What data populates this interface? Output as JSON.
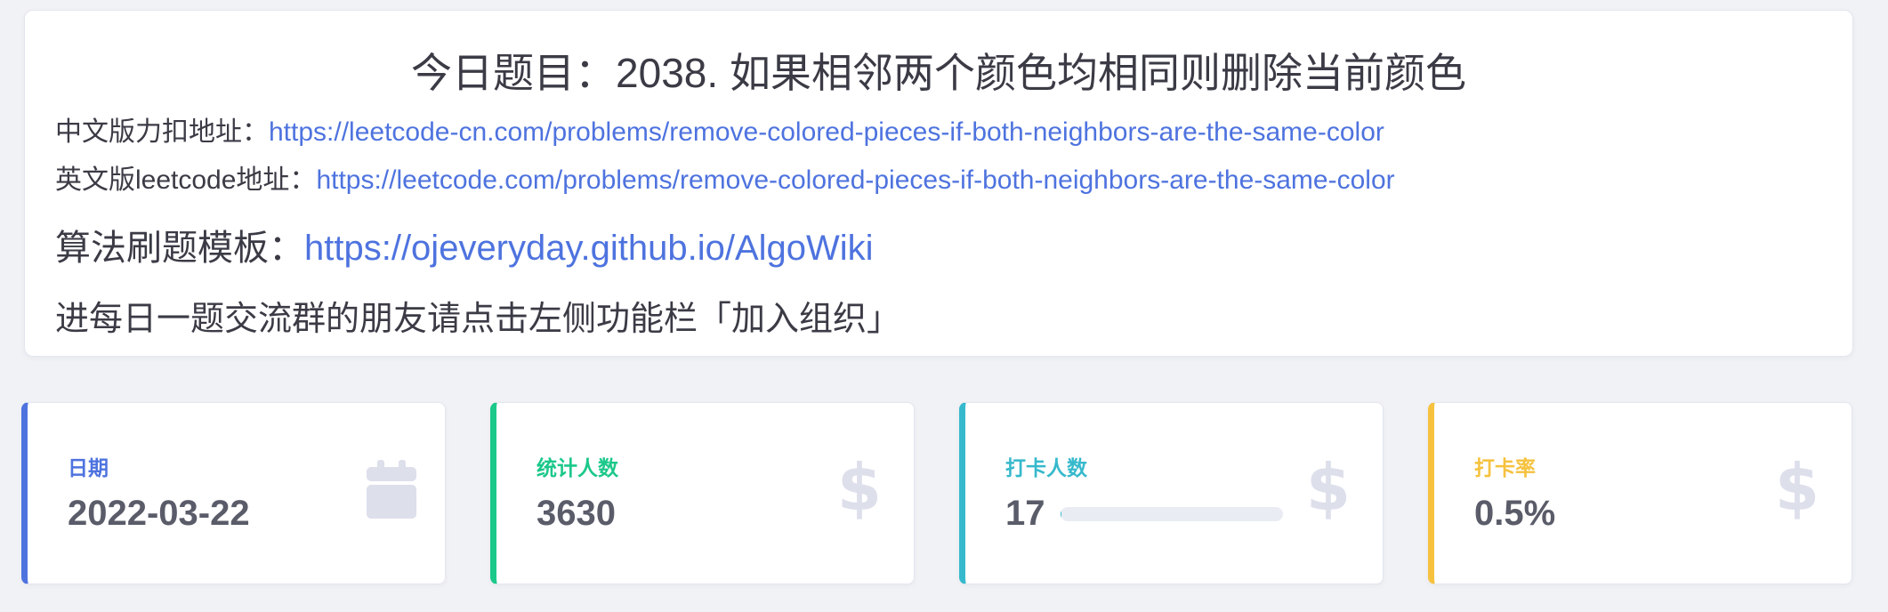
{
  "header": {
    "title": "今日题目：2038. 如果相邻两个颜色均相同则删除当前颜色",
    "cn_link_label": "中文版力扣地址：",
    "cn_link_url": "https://leetcode-cn.com/problems/remove-colored-pieces-if-both-neighbors-are-the-same-color",
    "en_link_label": "英文版leetcode地址：",
    "en_link_url": "https://leetcode.com/problems/remove-colored-pieces-if-both-neighbors-are-the-same-color",
    "template_label": "算法刷题模板：",
    "template_url": "https://ojeveryday.github.io/AlgoWiki",
    "group_text": "进每日一题交流群的朋友请点击左侧功能栏「加入组织」"
  },
  "stats": {
    "date": {
      "label": "日期",
      "value": "2022-03-22",
      "icon": "calendar-icon",
      "color": "#4e73df"
    },
    "total": {
      "label": "统计人数",
      "value": "3630",
      "icon": "dollar-icon",
      "color": "#1cc88a"
    },
    "checkin": {
      "label": "打卡人数",
      "value": "17",
      "icon": "dollar-icon",
      "color": "#36b9cc",
      "progress_fraction": 0.005
    },
    "rate": {
      "label": "打卡率",
      "value": "0.5%",
      "icon": "dollar-icon",
      "color": "#f6c23e"
    }
  }
}
